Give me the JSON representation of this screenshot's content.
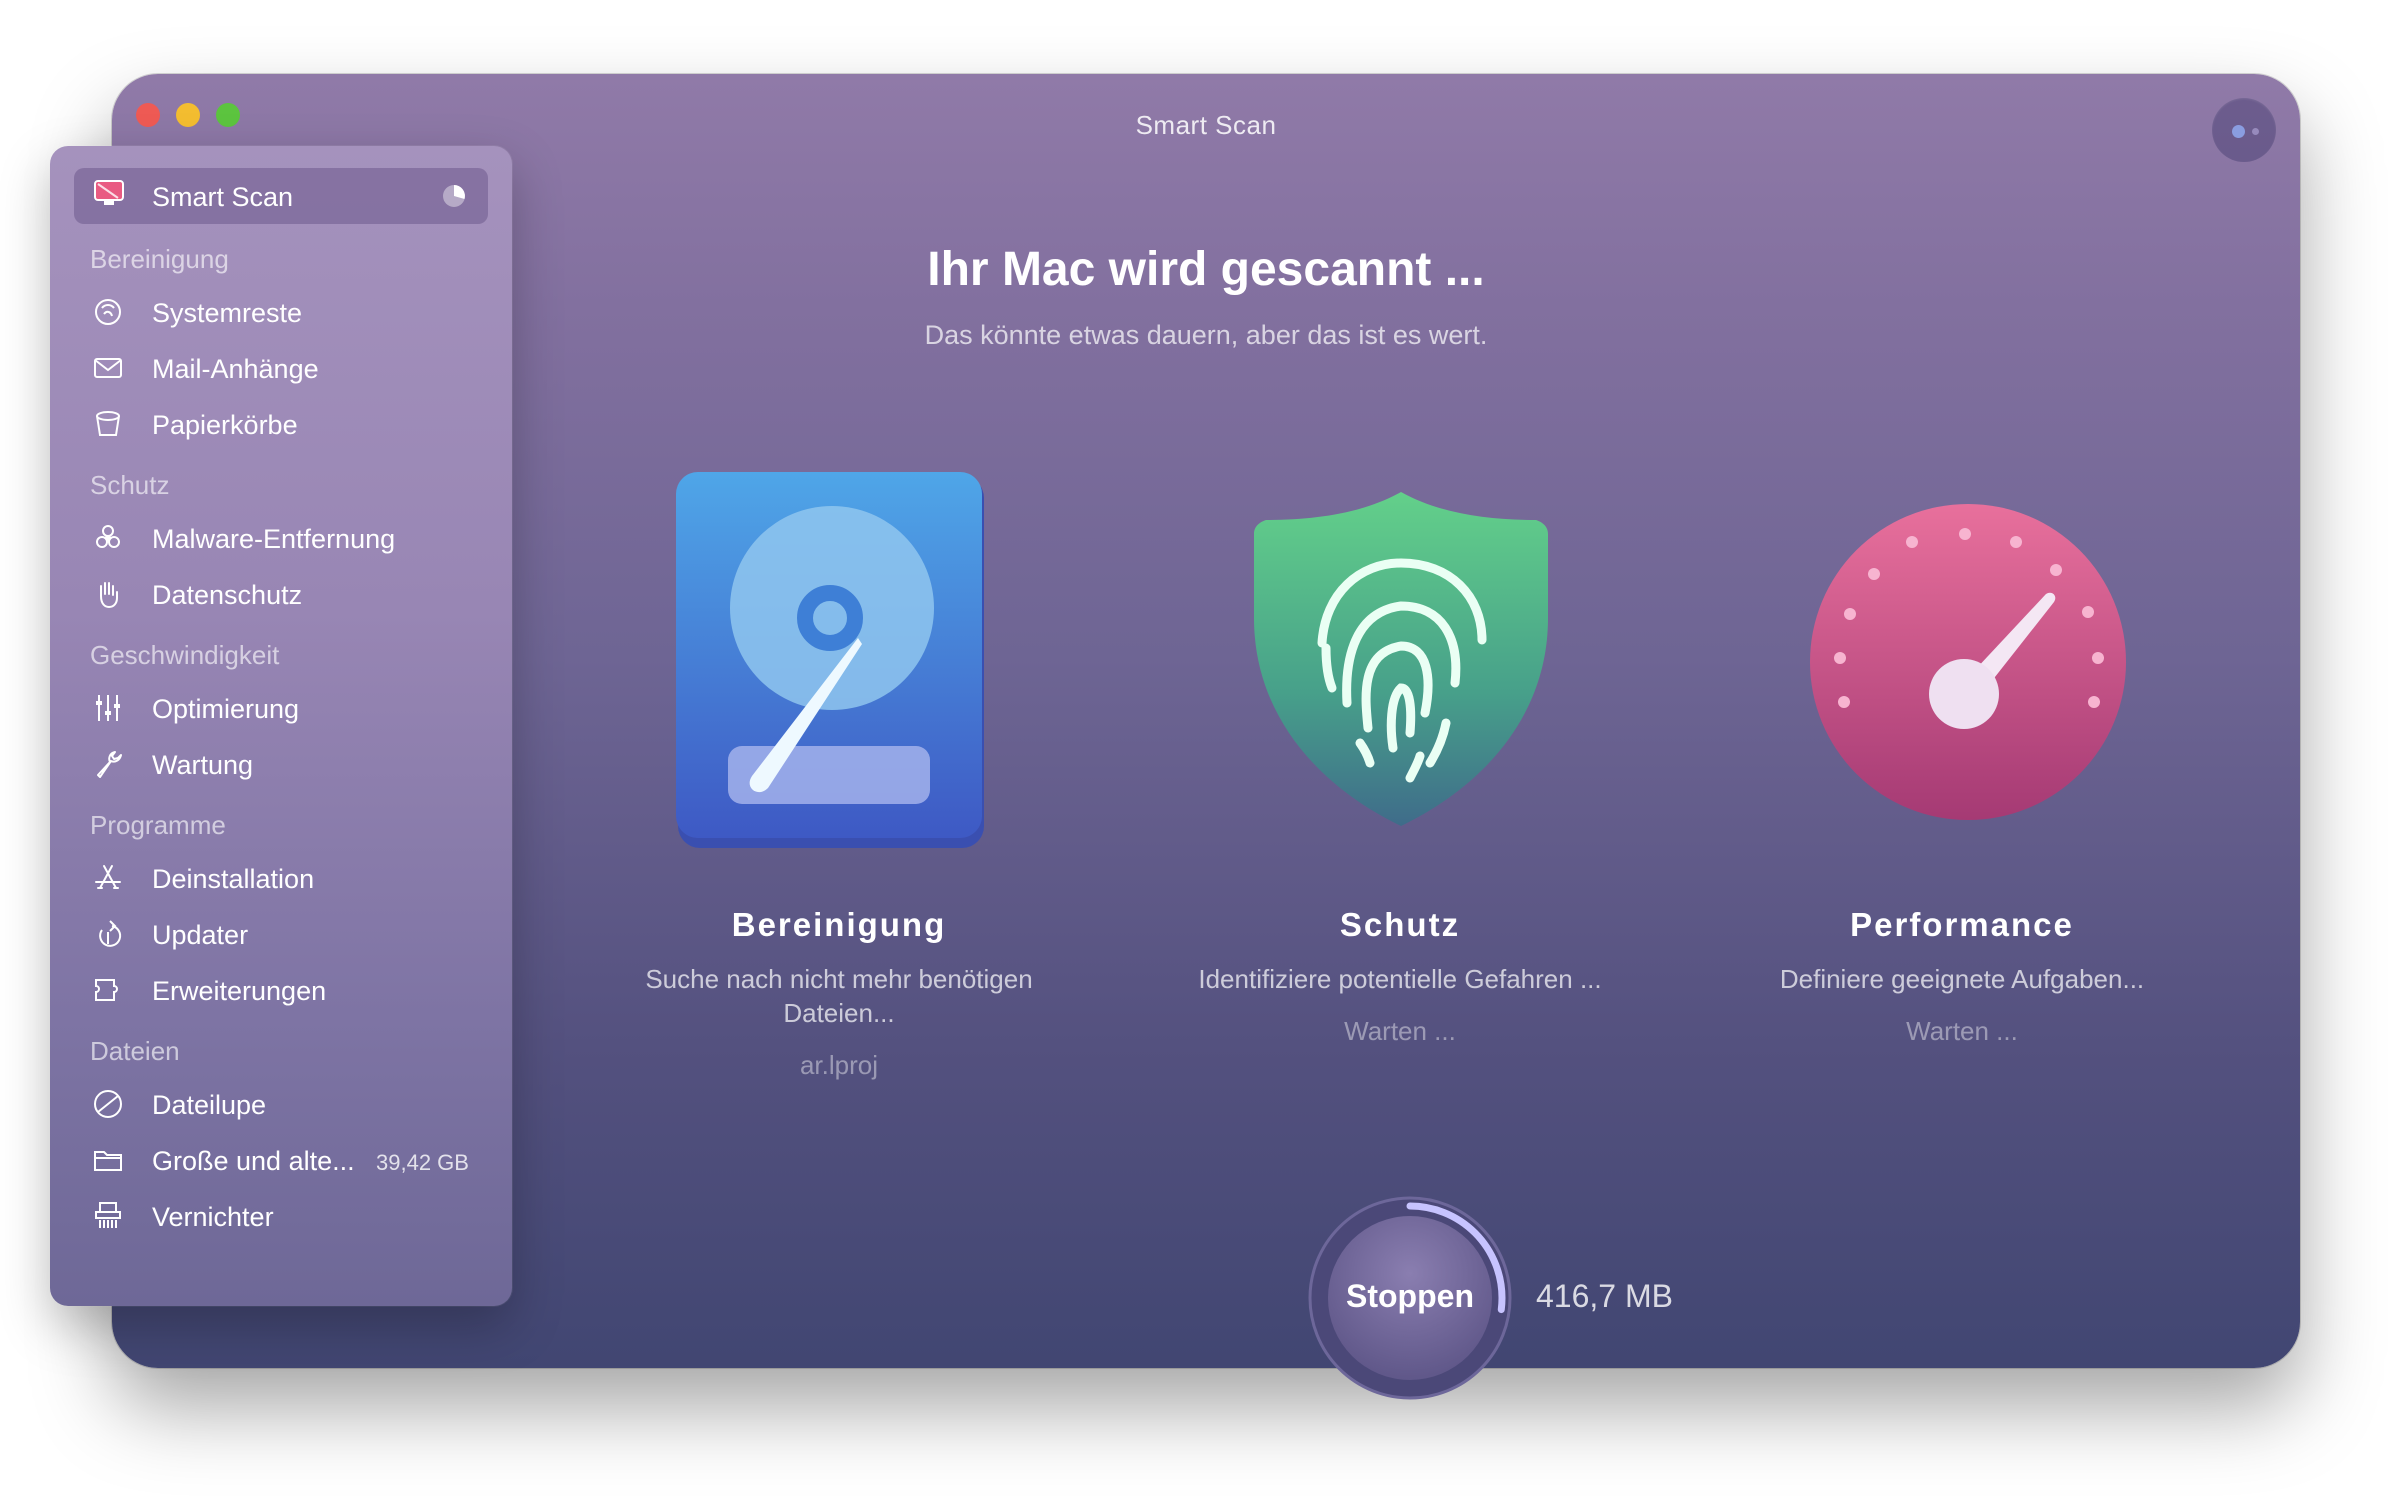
{
  "window": {
    "title": "Smart Scan"
  },
  "sidebar": {
    "active": {
      "label": "Smart Scan",
      "icon": "monitor-icon"
    },
    "sections": [
      {
        "heading": "Bereinigung",
        "items": [
          {
            "label": "Systemreste",
            "icon": "system-junk-icon"
          },
          {
            "label": "Mail-Anhänge",
            "icon": "envelope-icon"
          },
          {
            "label": "Papierkörbe",
            "icon": "trash-bin-icon"
          }
        ]
      },
      {
        "heading": "Schutz",
        "items": [
          {
            "label": "Malware-Entfernung",
            "icon": "biohazard-icon"
          },
          {
            "label": "Datenschutz",
            "icon": "hand-icon"
          }
        ]
      },
      {
        "heading": "Geschwindigkeit",
        "items": [
          {
            "label": "Optimierung",
            "icon": "sliders-icon"
          },
          {
            "label": "Wartung",
            "icon": "wrench-icon"
          }
        ]
      },
      {
        "heading": "Programme",
        "items": [
          {
            "label": "Deinstallation",
            "icon": "app-store-icon"
          },
          {
            "label": "Updater",
            "icon": "update-arrow-icon"
          },
          {
            "label": "Erweiterungen",
            "icon": "extension-icon"
          }
        ]
      },
      {
        "heading": "Dateien",
        "items": [
          {
            "label": "Dateilupe",
            "icon": "space-lens-icon"
          },
          {
            "label": "Große und alte...",
            "icon": "folder-icon",
            "extra": "39,42 GB"
          },
          {
            "label": "Vernichter",
            "icon": "shredder-icon"
          }
        ]
      }
    ]
  },
  "main": {
    "heading": "Ihr Mac wird gescannt ...",
    "subheading": "Das könnte etwas dauern, aber das ist es wert.",
    "modules": [
      {
        "title": "Bereinigung",
        "description": "Suche nach nicht mehr benötigen Dateien...",
        "status": "ar.lproj",
        "icon": "hard-drive-icon"
      },
      {
        "title": "Schutz",
        "description": "Identifiziere potentielle Gefahren ...",
        "status": "Warten ...",
        "icon": "shield-fingerprint-icon"
      },
      {
        "title": "Performance",
        "description": "Definiere geeignete Aufgaben...",
        "status": "Warten ...",
        "icon": "speedometer-icon"
      }
    ],
    "stop_button": "Stoppen",
    "scanned_size": "416,7 MB",
    "scan_progress": 0.27
  },
  "colors": {
    "red": "#ee5a54",
    "yellow": "#f3bd30",
    "green": "#5cc43f",
    "progress": "#c7c3ff"
  }
}
